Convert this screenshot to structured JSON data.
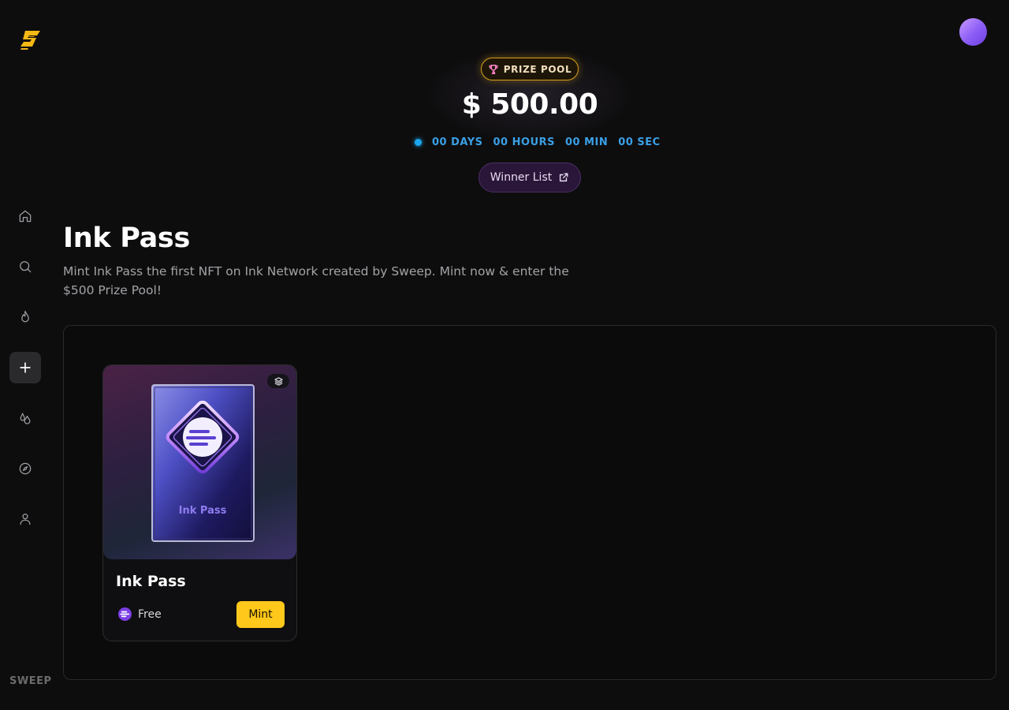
{
  "brand": {
    "footer_text": "SWEEP",
    "logo_icon": "sweep-logo-icon"
  },
  "sidebar": {
    "items": [
      {
        "name": "home",
        "icon": "home-icon"
      },
      {
        "name": "search",
        "icon": "search-icon"
      },
      {
        "name": "trending",
        "icon": "flame-icon"
      },
      {
        "name": "create",
        "icon": "plus-icon",
        "active": true
      },
      {
        "name": "drops",
        "icon": "drops-icon"
      },
      {
        "name": "explore",
        "icon": "compass-icon"
      },
      {
        "name": "profile",
        "icon": "user-icon"
      }
    ]
  },
  "prize": {
    "badge_label": "PRIZE POOL",
    "amount": "$ 500.00",
    "countdown": {
      "days": "00 DAYS",
      "hours": "00 HOURS",
      "min": "00 MIN",
      "sec": "00 SEC"
    },
    "winner_button_label": "Winner List"
  },
  "page": {
    "title": "Ink Pass",
    "description": "Mint Ink Pass the first NFT on Ink Network created by Sweep. Mint now & enter the $500 Prize Pool!"
  },
  "collection": {
    "cards": [
      {
        "title": "Ink Pass",
        "art_label": "Ink Pass",
        "price": "Free",
        "action_label": "Mint"
      }
    ]
  },
  "colors": {
    "background": "#0e0d0e",
    "accent_yellow": "#ffc81a",
    "countdown_blue": "#3aa0e6",
    "badge_gold": "#d39b1a",
    "winner_purple": "#2a1638"
  }
}
